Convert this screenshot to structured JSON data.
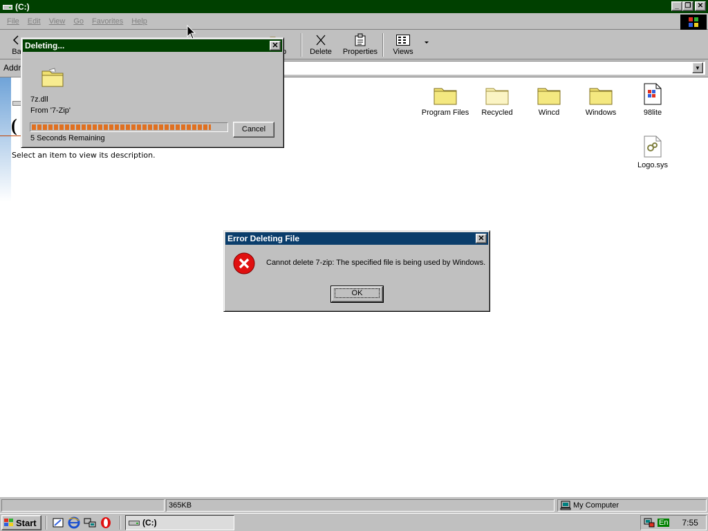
{
  "window": {
    "title": "(C:)"
  },
  "menu": [
    "File",
    "Edit",
    "View",
    "Go",
    "Favorites",
    "Help"
  ],
  "toolbar": {
    "back_label": "Ba",
    "up_label": "p",
    "delete_label": "Delete",
    "properties_label": "Properties",
    "views_label": "Views"
  },
  "address": {
    "label": "Addr",
    "value": ""
  },
  "content": {
    "drive_heading": "(",
    "description": "Select an item to view its description."
  },
  "files": [
    {
      "name": "Program Files",
      "icon": "folder-icon"
    },
    {
      "name": "Recycled",
      "icon": "recycle-folder-icon"
    },
    {
      "name": "Wincd",
      "icon": "folder-icon"
    },
    {
      "name": "Windows",
      "icon": "folder-icon"
    },
    {
      "name": "98lite",
      "icon": "executable-icon"
    },
    {
      "name": "Logo.sys",
      "icon": "system-file-icon"
    }
  ],
  "status": {
    "size": "365KB",
    "zone": "My Computer"
  },
  "taskbar": {
    "start_label": "Start",
    "task_label": "(C:)",
    "lang": "En",
    "clock": "7:55"
  },
  "deleting_dialog": {
    "title": "Deleting...",
    "file_name": "7z.dll",
    "from_text": "From '7-Zip'",
    "progress": 0.92,
    "time_remaining": "5 Seconds Remaining",
    "cancel_label": "Cancel"
  },
  "error_dialog": {
    "title": "Error Deleting File",
    "message": "Cannot delete 7-zip: The specified file is being used by Windows.",
    "ok_label": "OK"
  },
  "colors": {
    "titlebar": "#004000",
    "error_title": "#0a3d6b",
    "progress_fill": "#e07020",
    "folder": "#f0e070"
  }
}
